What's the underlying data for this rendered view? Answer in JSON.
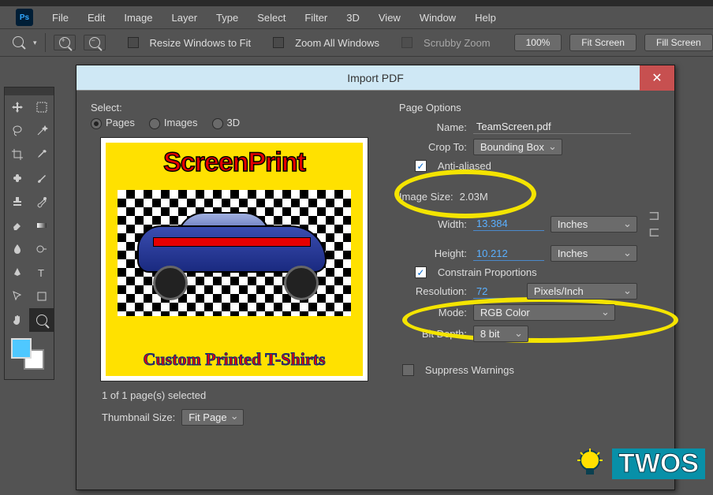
{
  "menubar": {
    "items": [
      "File",
      "Edit",
      "Image",
      "Layer",
      "Type",
      "Select",
      "Filter",
      "3D",
      "View",
      "Window",
      "Help"
    ]
  },
  "optionsBar": {
    "resizeLabel": "Resize Windows to Fit",
    "zoomAllLabel": "Zoom All Windows",
    "scrubbyLabel": "Scrubby Zoom",
    "zoomPct": "100%",
    "fitScreen": "Fit Screen",
    "fillScreen": "Fill Screen"
  },
  "dialog": {
    "title": "Import PDF",
    "selectLabel": "Select:",
    "radios": {
      "pages": "Pages",
      "images": "Images",
      "threeD": "3D"
    },
    "preview": {
      "logo": "ScreenPrint",
      "tagline": "Custom Printed T-Shirts"
    },
    "pagesSelected": "1 of 1 page(s) selected",
    "thumbLabel": "Thumbnail Size:",
    "thumbValue": "Fit Page",
    "pageOptions": {
      "header": "Page Options",
      "nameLabel": "Name:",
      "nameValue": "TeamScreen.pdf",
      "cropLabel": "Crop To:",
      "cropValue": "Bounding Box",
      "antiAliased": "Anti-aliased",
      "imageSizeLabel": "Image Size:",
      "imageSizeValue": "2.03M",
      "widthLabel": "Width:",
      "widthValue": "13.384",
      "widthUnit": "Inches",
      "heightLabel": "Height:",
      "heightValue": "10.212",
      "heightUnit": "Inches",
      "constrain": "Constrain Proportions",
      "resLabel": "Resolution:",
      "resValue": "72",
      "resUnit": "Pixels/Inch",
      "modeLabel": "Mode:",
      "modeValue": "RGB Color",
      "bitLabel": "Bit Depth:",
      "bitValue": "8 bit",
      "suppress": "Suppress Warnings"
    }
  },
  "watermark": {
    "text": "TWOS"
  }
}
